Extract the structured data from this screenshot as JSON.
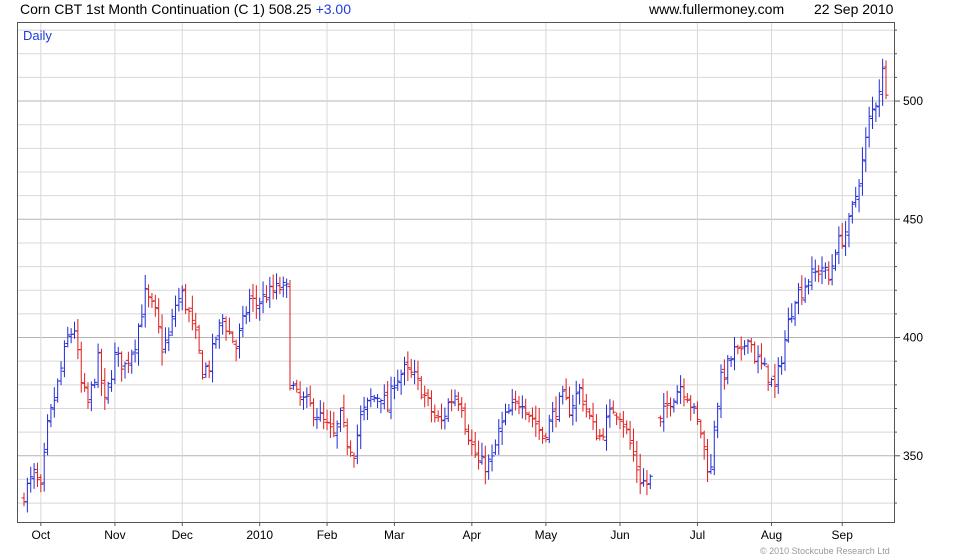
{
  "header": {
    "title": "Corn CBT 1st Month Continuation (C 1) 508.25",
    "change": "+3.00",
    "source": "www.fullermoney.com",
    "date": "22 Sep 2010"
  },
  "footer": {
    "copyright": "© 2010 Stockcube Research Ltd"
  },
  "colors": {
    "up": "#1f2bd6",
    "down": "#e01a1a",
    "grid": "#d8d8d8",
    "major_grid": "#b4b4b4"
  },
  "chart_data": {
    "type": "ohlc",
    "period_label": "Daily",
    "ylim": [
      322,
      533
    ],
    "y_ticks": [
      350,
      400,
      450,
      500
    ],
    "y_tick_labels": [
      "350",
      "400",
      "450",
      "500"
    ],
    "x_tick_labels": [
      "Oct",
      "Nov",
      "Dec",
      "2010",
      "Feb",
      "Mar",
      "Apr",
      "May",
      "Jun",
      "Jul",
      "Aug",
      "Sep"
    ],
    "x_tick_positions": [
      5,
      27,
      47,
      70,
      90,
      110,
      133,
      155,
      177,
      200,
      222,
      243
    ],
    "trading_days": 257,
    "price_path": [
      [
        0,
        334
      ],
      [
        3,
        342
      ],
      [
        5,
        335
      ],
      [
        7,
        362
      ],
      [
        10,
        380
      ],
      [
        13,
        400
      ],
      [
        15,
        404
      ],
      [
        17,
        380
      ],
      [
        19,
        372
      ],
      [
        22,
        390
      ],
      [
        24,
        372
      ],
      [
        27,
        392
      ],
      [
        30,
        388
      ],
      [
        33,
        398
      ],
      [
        36,
        418
      ],
      [
        39,
        410
      ],
      [
        41,
        396
      ],
      [
        43,
        400
      ],
      [
        45,
        414
      ],
      [
        47,
        418
      ],
      [
        49,
        410
      ],
      [
        51,
        400
      ],
      [
        53,
        386
      ],
      [
        55,
        388
      ],
      [
        57,
        400
      ],
      [
        59,
        408
      ],
      [
        61,
        402
      ],
      [
        63,
        396
      ],
      [
        65,
        406
      ],
      [
        67,
        416
      ],
      [
        69,
        414
      ],
      [
        72,
        418
      ],
      [
        76,
        421
      ],
      [
        78,
        420
      ],
      [
        78.5,
        392
      ],
      [
        79,
        382
      ],
      [
        81,
        375
      ],
      [
        84,
        372
      ],
      [
        87,
        368
      ],
      [
        90,
        362
      ],
      [
        92,
        358
      ],
      [
        94,
        366
      ],
      [
        96,
        356
      ],
      [
        98,
        352
      ],
      [
        100,
        366
      ],
      [
        103,
        374
      ],
      [
        106,
        376
      ],
      [
        108,
        370
      ],
      [
        110,
        382
      ],
      [
        113,
        386
      ],
      [
        116,
        383
      ],
      [
        118,
        378
      ],
      [
        120,
        372
      ],
      [
        122,
        366
      ],
      [
        124,
        364
      ],
      [
        126,
        372
      ],
      [
        128,
        376
      ],
      [
        130,
        372
      ],
      [
        131,
        364
      ],
      [
        133,
        354
      ],
      [
        135,
        347
      ],
      [
        137,
        346
      ],
      [
        139,
        348
      ],
      [
        141,
        360
      ],
      [
        143,
        366
      ],
      [
        145,
        370
      ],
      [
        148,
        374
      ],
      [
        150,
        368
      ],
      [
        152,
        364
      ],
      [
        154,
        358
      ],
      [
        156,
        364
      ],
      [
        158,
        370
      ],
      [
        160,
        374
      ],
      [
        162,
        370
      ],
      [
        165,
        378
      ],
      [
        167,
        370
      ],
      [
        169,
        362
      ],
      [
        171,
        358
      ],
      [
        173,
        364
      ],
      [
        175,
        370
      ],
      [
        177,
        368
      ],
      [
        179,
        360
      ],
      [
        181,
        350
      ],
      [
        183,
        340
      ],
      [
        185,
        338
      ],
      [
        186,
        340
      ],
      [
        187.5,
        0
      ],
      [
        188.5,
        362
      ],
      [
        190,
        368
      ],
      [
        192,
        374
      ],
      [
        195,
        380
      ],
      [
        197,
        376
      ],
      [
        199,
        368
      ],
      [
        201,
        360
      ],
      [
        203,
        346
      ],
      [
        204,
        344
      ],
      [
        205,
        364
      ],
      [
        207,
        382
      ],
      [
        209,
        388
      ],
      [
        211,
        394
      ],
      [
        213,
        392
      ],
      [
        215,
        402
      ],
      [
        217,
        392
      ],
      [
        219,
        388
      ],
      [
        221,
        384
      ],
      [
        223,
        378
      ],
      [
        225,
        392
      ],
      [
        227,
        406
      ],
      [
        229,
        418
      ],
      [
        231,
        420
      ],
      [
        233,
        425
      ],
      [
        235,
        427
      ],
      [
        237,
        430
      ],
      [
        239,
        424
      ],
      [
        241,
        438
      ],
      [
        243,
        442
      ],
      [
        245,
        448
      ],
      [
        247,
        460
      ],
      [
        249,
        474
      ],
      [
        251,
        492
      ],
      [
        253,
        500
      ],
      [
        255,
        512
      ],
      [
        256,
        506
      ]
    ],
    "grid": true,
    "legend": "none"
  }
}
